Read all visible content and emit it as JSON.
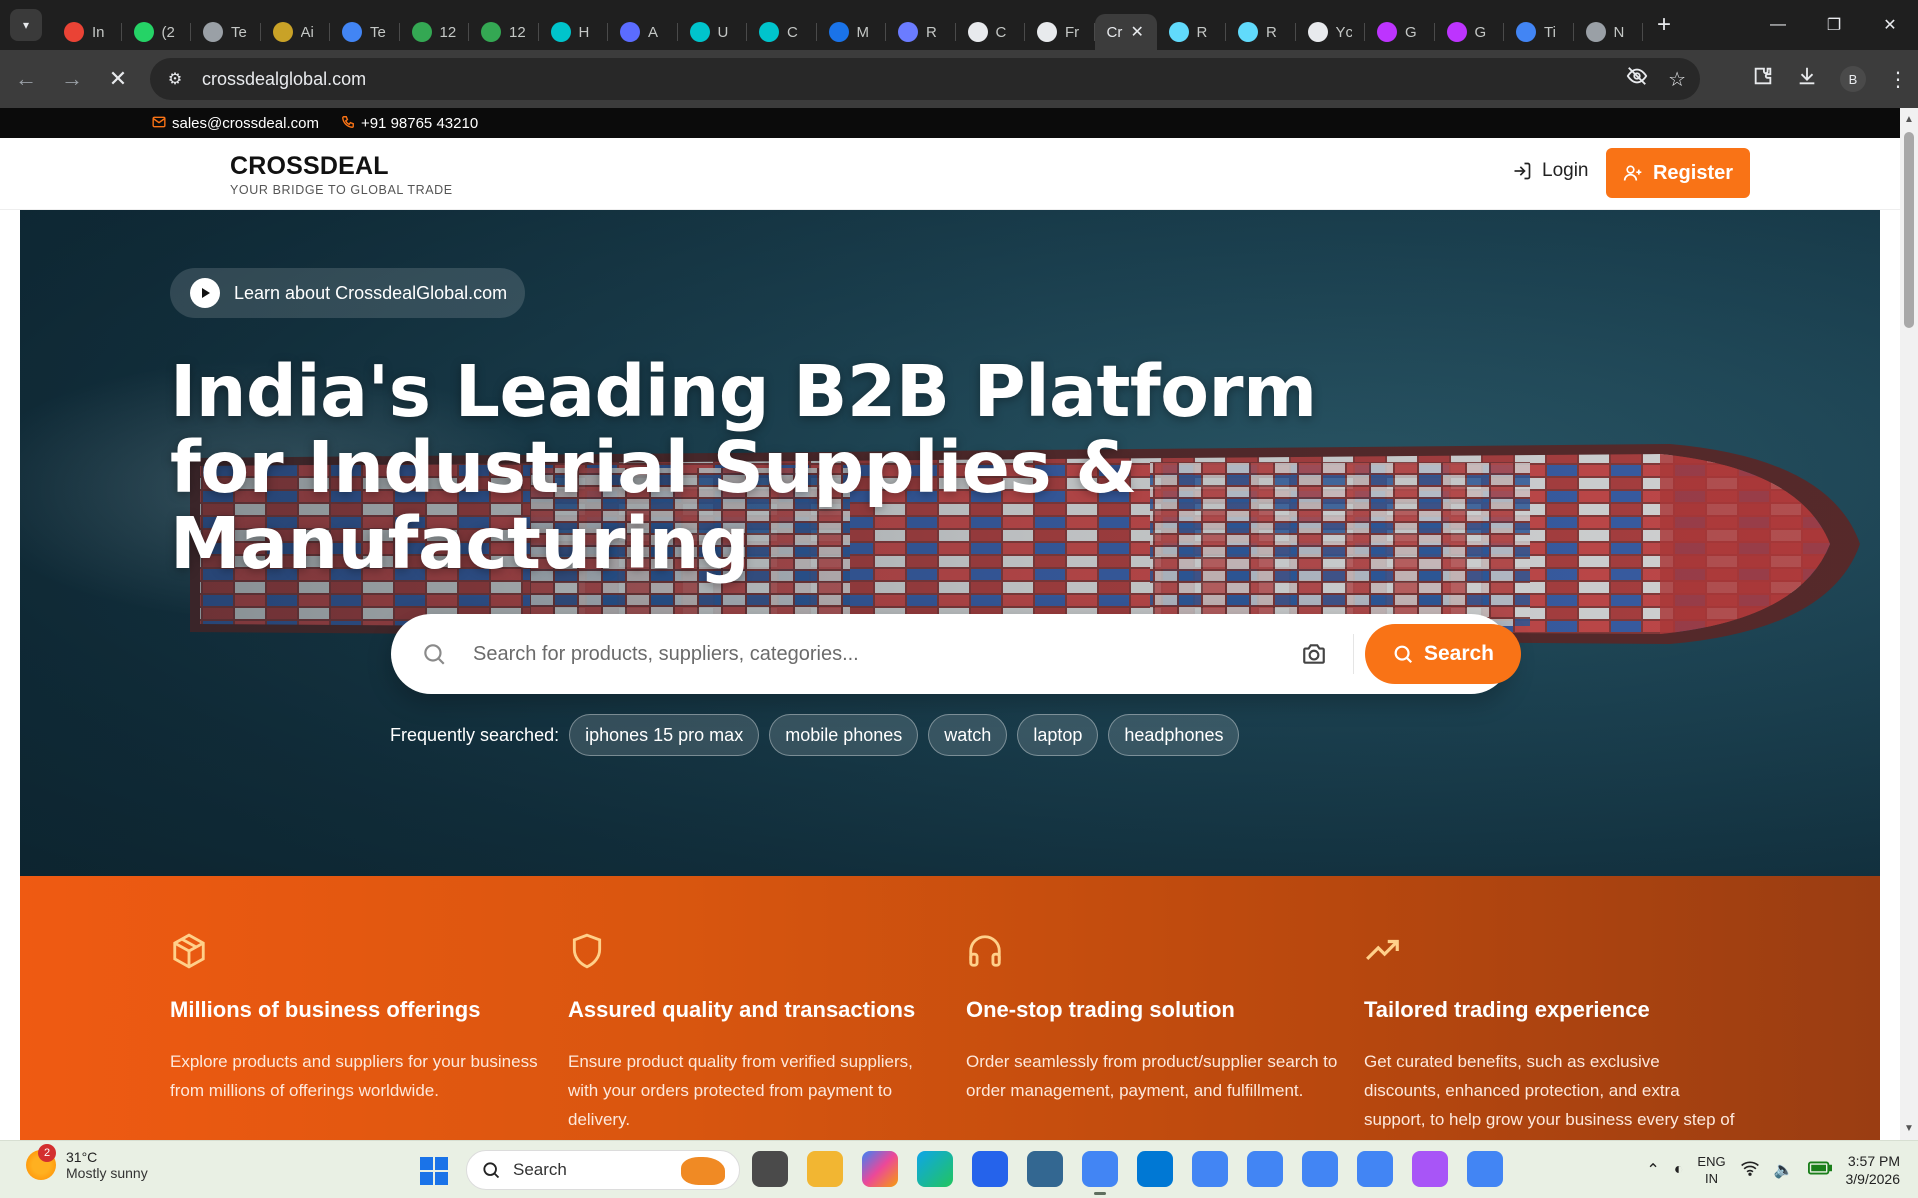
{
  "browser": {
    "tabs": [
      {
        "title": "In",
        "icon": "gmail-icon",
        "color": "#ea4335"
      },
      {
        "title": "(2",
        "icon": "whatsapp-icon",
        "color": "#25d366"
      },
      {
        "title": "Te",
        "icon": "globe-icon",
        "color": "#9aa0a6"
      },
      {
        "title": "Ai",
        "icon": "ai-icon",
        "color": "#c9a227"
      },
      {
        "title": "Te",
        "icon": "google-icon",
        "color": "#4285f4"
      },
      {
        "title": "12",
        "icon": "maps-pin-icon",
        "color": "#34a853"
      },
      {
        "title": "12",
        "icon": "maps-pin-icon",
        "color": "#34a853"
      },
      {
        "title": "H",
        "icon": "canva-icon",
        "color": "#00c4cc"
      },
      {
        "title": "A",
        "icon": "app-icon",
        "color": "#5b6cff"
      },
      {
        "title": "U",
        "icon": "canva-icon",
        "color": "#00c4cc"
      },
      {
        "title": "C",
        "icon": "canva-icon",
        "color": "#00c4cc"
      },
      {
        "title": "M",
        "icon": "meet-icon",
        "color": "#1a73e8"
      },
      {
        "title": "R",
        "icon": "r-icon",
        "color": "#6b7cff"
      },
      {
        "title": "C",
        "icon": "chatgpt-icon",
        "color": "#e8eaed"
      },
      {
        "title": "Fr",
        "icon": "prompt-icon",
        "color": "#e8eaed"
      },
      {
        "title": "Cr",
        "icon": "",
        "color": ""
      },
      {
        "title": "R",
        "icon": "react-icon",
        "color": "#61dafb"
      },
      {
        "title": "R",
        "icon": "react-icon",
        "color": "#61dafb"
      },
      {
        "title": "Yc",
        "icon": "github-icon",
        "color": "#e8eaed"
      },
      {
        "title": "G",
        "icon": "vite-icon",
        "color": "#bd34fe"
      },
      {
        "title": "G",
        "icon": "vite-icon",
        "color": "#bd34fe"
      },
      {
        "title": "Ti",
        "icon": "google-icon",
        "color": "#4285f4"
      },
      {
        "title": "N",
        "icon": "globe-icon",
        "color": "#9aa0a6"
      }
    ],
    "url": "crossdealglobal.com",
    "profile_initial": "B"
  },
  "topbar": {
    "email": "sales@crossdeal.com",
    "phone": "+91 98765 43210"
  },
  "header": {
    "brand_name": "CROSSDEAL",
    "brand_tagline": "YOUR BRIDGE TO GLOBAL TRADE",
    "login_label": "Login",
    "register_label": "Register"
  },
  "hero": {
    "learn_label": "Learn about CrossdealGlobal.com",
    "headline_line1": "India's Leading B2B Platform",
    "headline_line2": "for Industrial Supplies &",
    "headline_line3": "Manufacturing",
    "search_placeholder": "Search for products, suppliers, categories...",
    "search_button": "Search",
    "frequent_label": "Frequently searched:",
    "frequent": [
      "iphones 15 pro max",
      "mobile phones",
      "watch",
      "laptop",
      "headphones"
    ]
  },
  "features": [
    {
      "title": "Millions of business offerings",
      "text": "Explore products and suppliers for your business from millions of offerings worldwide.",
      "icon": "box-icon"
    },
    {
      "title": "Assured quality and transactions",
      "text": "Ensure product quality from verified suppliers, with your orders protected from payment to delivery.",
      "icon": "shield-icon"
    },
    {
      "title": "One-stop trading solution",
      "text": "Order seamlessly from product/supplier search to order management, payment, and fulfillment.",
      "icon": "headphones-icon"
    },
    {
      "title": "Tailored trading experience",
      "text": "Get curated benefits, such as exclusive discounts, enhanced protection, and extra support, to help grow your business every step of the way.",
      "icon": "trending-up-icon"
    }
  ],
  "colors": {
    "accent": "#f97316",
    "topbar_bg": "#0b0b0b"
  },
  "taskbar": {
    "weather_temp": "31°C",
    "weather_desc": "Mostly sunny",
    "weather_badge": "2",
    "search_label": "Search",
    "lang_line1": "ENG",
    "lang_line2": "IN",
    "time": "3:57 PM",
    "date": "3/9/2026"
  }
}
